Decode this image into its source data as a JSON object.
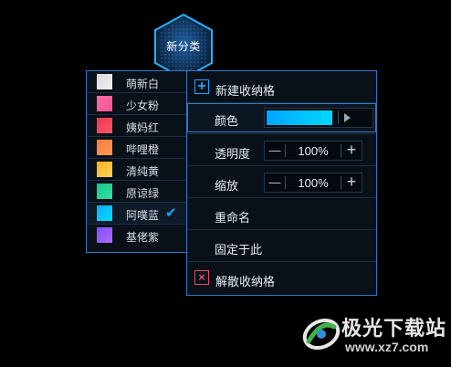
{
  "badge": {
    "label": "新分类"
  },
  "color_list": {
    "selected_index": 6,
    "items": [
      {
        "label": "萌新白",
        "gradient": [
          "#d8d8d8",
          "#f2f2f2"
        ]
      },
      {
        "label": "少女粉",
        "gradient": [
          "#ff6fa0",
          "#f0509a"
        ]
      },
      {
        "label": "姨妈红",
        "gradient": [
          "#e8344e",
          "#ff5a6a"
        ]
      },
      {
        "label": "哔哩橙",
        "gradient": [
          "#ff7a3a",
          "#ff9a55"
        ]
      },
      {
        "label": "清纯黄",
        "gradient": [
          "#ffb020",
          "#ffd35a"
        ]
      },
      {
        "label": "原谅绿",
        "gradient": [
          "#13c98a",
          "#37e0a0"
        ]
      },
      {
        "label": "阿噗蓝",
        "gradient": [
          "#12a8ff",
          "#00e0ff"
        ]
      },
      {
        "label": "基佬紫",
        "gradient": [
          "#7a4dff",
          "#b36bff"
        ]
      }
    ],
    "check_glyph": "✔"
  },
  "menu": {
    "new_box": "新建收纳格",
    "color_label": "颜色",
    "color_value": [
      "#00a6ff",
      "#00d8ff"
    ],
    "opacity_label": "透明度",
    "opacity_value": "100%",
    "zoom_label": "缩放",
    "zoom_value": "100%",
    "rename": "重命名",
    "pin_here": "固定于此",
    "dissolve": "解散收纳格",
    "minus_glyph": "—",
    "plus_glyph": "+",
    "new_icon_glyph": "+",
    "close_icon_glyph": "×"
  },
  "watermark": {
    "title": "极光下载站",
    "url": "www.xz7.com"
  },
  "colors": {
    "accent": "#1aa3ff",
    "border": "#2f79c6",
    "danger": "#e0506a",
    "panel_bg": "#0a1018"
  }
}
